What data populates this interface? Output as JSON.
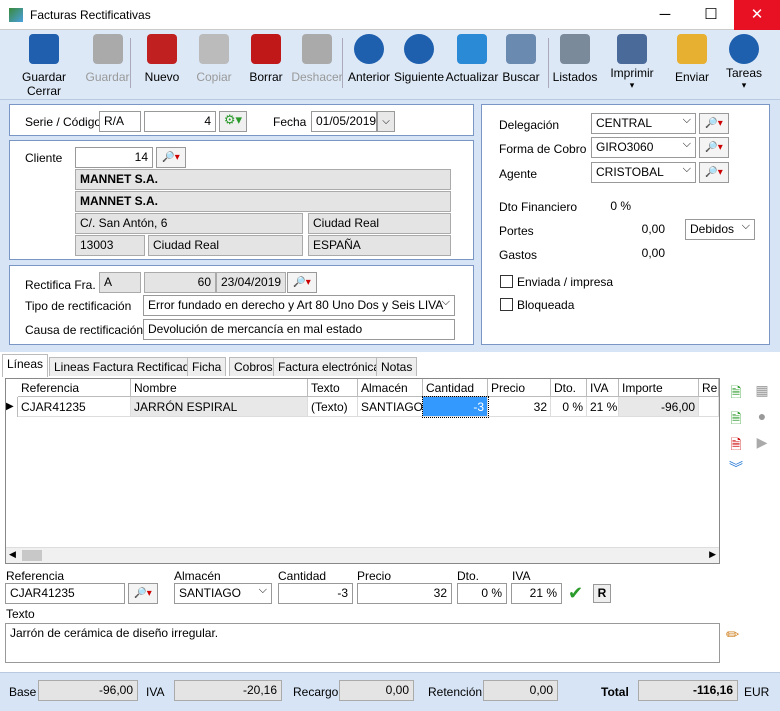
{
  "window": {
    "title": "Facturas Rectificativas",
    "minimize": "─",
    "maximize": "☐",
    "close": "✕"
  },
  "toolbar": [
    {
      "label": "Guardar Cerrar",
      "icon": "save-close-icon",
      "enabled": true,
      "color": "#1f5fae"
    },
    {
      "label": "Guardar",
      "icon": "save-icon",
      "enabled": false,
      "color": "#aaaaaa"
    },
    {
      "label": "Nuevo",
      "icon": "new-icon",
      "enabled": true,
      "color": "#c02020"
    },
    {
      "label": "Copiar",
      "icon": "copy-icon",
      "enabled": false,
      "color": "#bbbbbb"
    },
    {
      "label": "Borrar",
      "icon": "delete-icon",
      "enabled": true,
      "color": "#c01818"
    },
    {
      "label": "Deshacer",
      "icon": "undo-icon",
      "enabled": false,
      "color": "#aaaaaa"
    },
    {
      "label": "Anterior",
      "icon": "up-arrow-icon",
      "enabled": true,
      "color": "#1e5fae"
    },
    {
      "label": "Siguiente",
      "icon": "down-arrow-icon",
      "enabled": true,
      "color": "#1e5fae"
    },
    {
      "label": "Actualizar",
      "icon": "refresh-icon",
      "enabled": true,
      "color": "#2a8ad6"
    },
    {
      "label": "Buscar",
      "icon": "search-icon",
      "enabled": true,
      "color": "#6a8ab0"
    },
    {
      "label": "Listados",
      "icon": "reports-icon",
      "enabled": true,
      "color": "#7a8a9a"
    },
    {
      "label": "Imprimir",
      "icon": "printer-icon",
      "enabled": true,
      "color": "#4a6a9a",
      "dropdown": true
    },
    {
      "label": "Enviar",
      "icon": "envelope-icon",
      "enabled": true,
      "color": "#e8b030"
    },
    {
      "label": "Tareas",
      "icon": "clock-icon",
      "enabled": true,
      "color": "#1e5fae",
      "dropdown": true
    }
  ],
  "header": {
    "serie_label": "Serie / Código",
    "serie": "R/A",
    "codigo": "4",
    "fecha_label": "Fecha",
    "fecha": "01/05/2019"
  },
  "cliente": {
    "label": "Cliente",
    "code": "14",
    "name1": "MANNET S.A.",
    "name2": "MANNET S.A.",
    "address": "C/. San Antón, 6",
    "city": "Ciudad Real",
    "zip": "13003",
    "city2": "Ciudad Real",
    "country": "ESPAÑA"
  },
  "rectifica": {
    "label": "Rectifica Fra.",
    "serie": "A",
    "numero": "60",
    "fecha": "23/04/2019",
    "tipo_label": "Tipo de rectificación",
    "tipo": "Error fundado en derecho y Art 80 Uno Dos y Seis LIVA",
    "causa_label": "Causa de rectificación",
    "causa": "Devolución de mercancía en mal estado"
  },
  "right": {
    "delegacion_label": "Delegación",
    "delegacion": "CENTRAL",
    "forma_label": "Forma de Cobro",
    "forma": "GIRO3060",
    "agente_label": "Agente",
    "agente": "CRISTOBAL",
    "dto_label": "Dto Financiero",
    "dto": "0 %",
    "portes_label": "Portes",
    "portes": "0,00",
    "portes_tipo": "Debidos",
    "gastos_label": "Gastos",
    "gastos": "0,00",
    "enviada_label": "Enviada / impresa",
    "bloqueada_label": "Bloqueada"
  },
  "tabs": [
    "Líneas",
    "Lineas Factura Rectificada",
    "Ficha",
    "Cobros",
    "Factura electrónica",
    "Notas"
  ],
  "grid": {
    "columns": [
      "Referencia",
      "Nombre",
      "Texto",
      "Almacén",
      "Cantidad",
      "Precio",
      "Dto.",
      "IVA",
      "Importe",
      "Re"
    ],
    "rows": [
      [
        "CJAR41235",
        "JARRÓN ESPIRAL",
        "(Texto)",
        "SANTIAGO",
        "-3",
        "32",
        "0 %",
        "21 %",
        "-96,00",
        ""
      ]
    ]
  },
  "edit": {
    "ref_label": "Referencia",
    "ref": "CJAR41235",
    "alm_label": "Almacén",
    "alm": "SANTIAGO",
    "cant_label": "Cantidad",
    "cant": "-3",
    "precio_label": "Precio",
    "precio": "32",
    "dto_label": "Dto.",
    "dto": "0 %",
    "iva_label": "IVA",
    "iva": "21 %",
    "r_button": "R",
    "texto_label": "Texto",
    "texto": "Jarrón de cerámica de diseño irregular."
  },
  "totals": {
    "base_label": "Base",
    "base": "-96,00",
    "iva_label": "IVA",
    "iva": "-20,16",
    "recargo_label": "Recargo",
    "recargo": "0,00",
    "retencion_label": "Retención",
    "retencion": "0,00",
    "total_label": "Total",
    "total": "-116,16",
    "currency": "EUR"
  }
}
